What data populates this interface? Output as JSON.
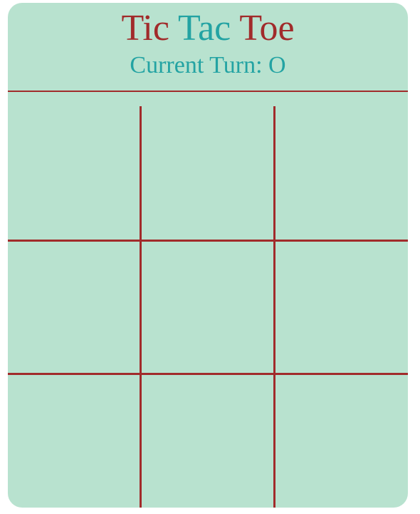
{
  "header": {
    "title_words": [
      "Tic",
      "Tac",
      "Toe"
    ],
    "turn_label": "Current Turn: O"
  },
  "board": {
    "cells": [
      "",
      "",
      "",
      "",
      "",
      "",
      "",
      "",
      ""
    ]
  },
  "colors": {
    "background": "#b8e2cf",
    "accent_red": "#a12b2b",
    "accent_teal": "#23a3a3"
  }
}
